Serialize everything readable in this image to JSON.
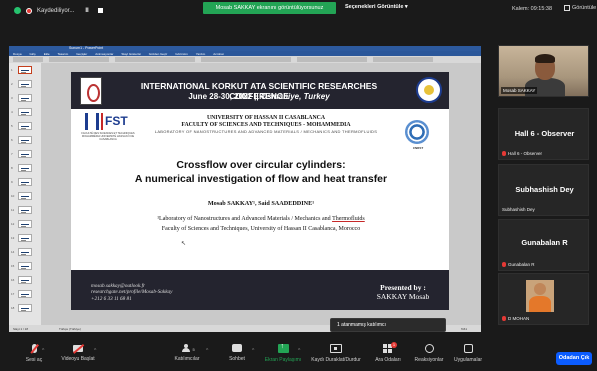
{
  "topbar": {
    "recording_label": "Kaydediliyor...",
    "pause_glyph": "II",
    "share_notice": "Mosab SAKKAY ekranını görüntülüyorsunuz",
    "view_options": "Seçenekleri Görüntüle",
    "view_options_caret": "▾",
    "talking": "Kalem: 09:15:38",
    "view_label": "Görüntüle"
  },
  "powerpoint": {
    "title_text": "Sunum1 - PowerPoint",
    "menu": [
      "Dosya",
      "Giriş",
      "Ekle",
      "Tasarım",
      "Geçişler",
      "Animasyonlar",
      "Slayt Gösterisi",
      "Gözden Geçir",
      "Görünüm",
      "Yardım",
      "Acrobat"
    ],
    "status_left": "Slayt 1 / 18",
    "status_lang": "Türkçe (Türkiye)",
    "status_zoom": "%61",
    "thumb_numbers": [
      "1",
      "2",
      "3",
      "4",
      "5",
      "6",
      "7",
      "8",
      "9",
      "10",
      "11",
      "12",
      "13",
      "14",
      "15",
      "16",
      "17",
      "18"
    ]
  },
  "slide": {
    "conference_title": "INTERNATIONAL KORKUT ATA SCIENTIFIC RESEARCHES CONFERENCE",
    "conference_date": "June 28-30, 2022 ||",
    "conference_place": "Osmaniye, Turkey",
    "fst_logo_text": "FST",
    "fst_subtitle": "FACULTÉ DES SCIENCES ET TECHNIQUES MOHAMMÉDIA UNIVERSITÉ HASSAN II DE CASABLANCA",
    "university": "UNIVERSITY OF HASSAN II CASABLANCA",
    "faculty": "FACULTY OF SCIENCES AND TECHNIQUES - MOHAMMEDIA",
    "lab_caps": "LABORATORY OF NANOSTRUCTURES AND ADVANCED MATERIALS / MECHANICS AND THERMOFLUIDS",
    "cnrst_label": "CNRST",
    "title_line1": "Crossflow over circular cylinders:",
    "title_line2": "A numerical investigation of flow and heat transfer",
    "authors": "Mosab SAKKAY¹, Said SAADEDDINE¹",
    "affiliation_line1": "¹Laboratory of Nanostructures and Advanced Materials / Mechanics and",
    "affiliation_underlined": "Thermofluids",
    "affiliation_line2": "Faculty of Sciences and Techniques, University of Hassan II Casablanca, Morocco",
    "email": "mosab.sakkay@outlook.fr",
    "researchgate": "researchgate.net/profile/Mosab-Sakkay",
    "phone": "+212 6 33 11 68 81",
    "presented_by": "Presented by :",
    "presenter": "SAKKAY Mosab"
  },
  "participants": [
    {
      "name": "Mosab SAKKAY",
      "type": "video"
    },
    {
      "name": "Hall 6 - Observer",
      "small": "Hall 6 - Observer",
      "muted": true
    },
    {
      "name": "Subhashish Dey",
      "small": "Subhashish Dey",
      "muted": false
    },
    {
      "name": "Gunabalan R",
      "small": "Gunabalan R",
      "muted": true
    },
    {
      "name": "",
      "small": "D MOHAN",
      "muted": true,
      "type": "photo"
    }
  ],
  "tooltip": "1 atanmamış katılımcı",
  "toolbar": {
    "mute": "Sesi aç",
    "video": "Videoyu Başlat",
    "participants": "Katılımcılar",
    "participants_count": "5",
    "chat": "Sohbet",
    "share": "Ekran Paylaşımı",
    "record": "Kaydı Duraklat/Durdur",
    "rooms": "Ara Odaları",
    "rooms_badge": "1",
    "reactions": "Reaksiyonlar",
    "apps": "Uygulamalar",
    "leave": "Odadan Çık",
    "caret": "^"
  },
  "colors": {
    "share_green": "#23a455",
    "leave_blue": "#0b5cff",
    "slide_band": "#24242f",
    "mute_red": "#e53935"
  }
}
